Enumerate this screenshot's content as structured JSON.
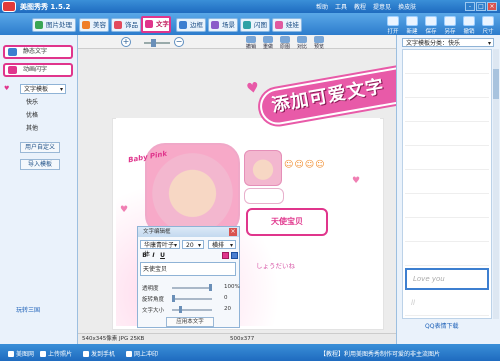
{
  "app": {
    "title": "美图秀秀 1.5.2"
  },
  "menu": [
    "帮助",
    "工具",
    "教程",
    "提意见",
    "换皮肤"
  ],
  "window_controls": [
    "-",
    "□",
    "×"
  ],
  "tabs": [
    {
      "label": "图片处理",
      "color": "#3aa655"
    },
    {
      "label": "美容",
      "color": "#ef7f2a"
    },
    {
      "label": "饰品",
      "color": "#e24a5c"
    },
    {
      "label": "文字",
      "color": "#e0358c",
      "active": true
    },
    {
      "label": "边框",
      "color": "#3d7fd0"
    },
    {
      "label": "场景",
      "color": "#8a5cc9"
    },
    {
      "label": "闪图",
      "color": "#2fa2a6"
    },
    {
      "label": "娃娃",
      "color": "#e05aa0"
    }
  ],
  "toolbar_actions": [
    "打开",
    "新建",
    "保存",
    "另存",
    "撤销",
    "尺寸"
  ],
  "left_panel": {
    "static_text_button": "静态文字",
    "animated_text_button": "动画闪字",
    "static_badge": "静",
    "animated_badge": "动",
    "template_select": "文字模板",
    "options": [
      "快乐",
      "优格",
      "其他"
    ],
    "custom_button": "用户自定义",
    "import_button": "导入模板",
    "bottom_link": "玩转三国"
  },
  "canvas_ops": [
    "撤销",
    "重做",
    "原图",
    "对比",
    "预览"
  ],
  "banner_text": "添加可爱文字",
  "photo": {
    "sign_text": "天使宝贝",
    "pink_text": "Baby Pink",
    "deco_text": "しょうだいね",
    "smileys": "☺☺☺☺"
  },
  "text_dialog": {
    "title": "文字编辑框",
    "close": "×",
    "font": "华康青叶子体",
    "size": "20",
    "effect": "横排",
    "bold": "B",
    "italic": "I",
    "underline": "U",
    "text_value": "天使宝贝",
    "sliders": [
      {
        "label": "透明度",
        "value": 100,
        "display": "100%"
      },
      {
        "label": "旋转角度",
        "value": 0,
        "display": "0"
      },
      {
        "label": "文字大小",
        "value": 20,
        "display": "20"
      }
    ],
    "apply_button": "应用本文字"
  },
  "center_status": {
    "left": "540x345像素 JPG 25KB",
    "right": "500x377"
  },
  "right_panel": {
    "select": "文字模板分类：快乐",
    "thumbs": [
      "",
      "",
      "",
      "",
      "",
      "",
      "",
      "",
      "",
      "Love you",
      "ll"
    ],
    "bottom_link": "QQ表情下载"
  },
  "statusbar": [
    {
      "label": "美图网"
    },
    {
      "label": "上传照片"
    },
    {
      "label": "发到手机"
    },
    {
      "label": "网上冲印"
    },
    {
      "label": "【教程】利用美图秀秀制作可爱的非主流图片"
    }
  ]
}
